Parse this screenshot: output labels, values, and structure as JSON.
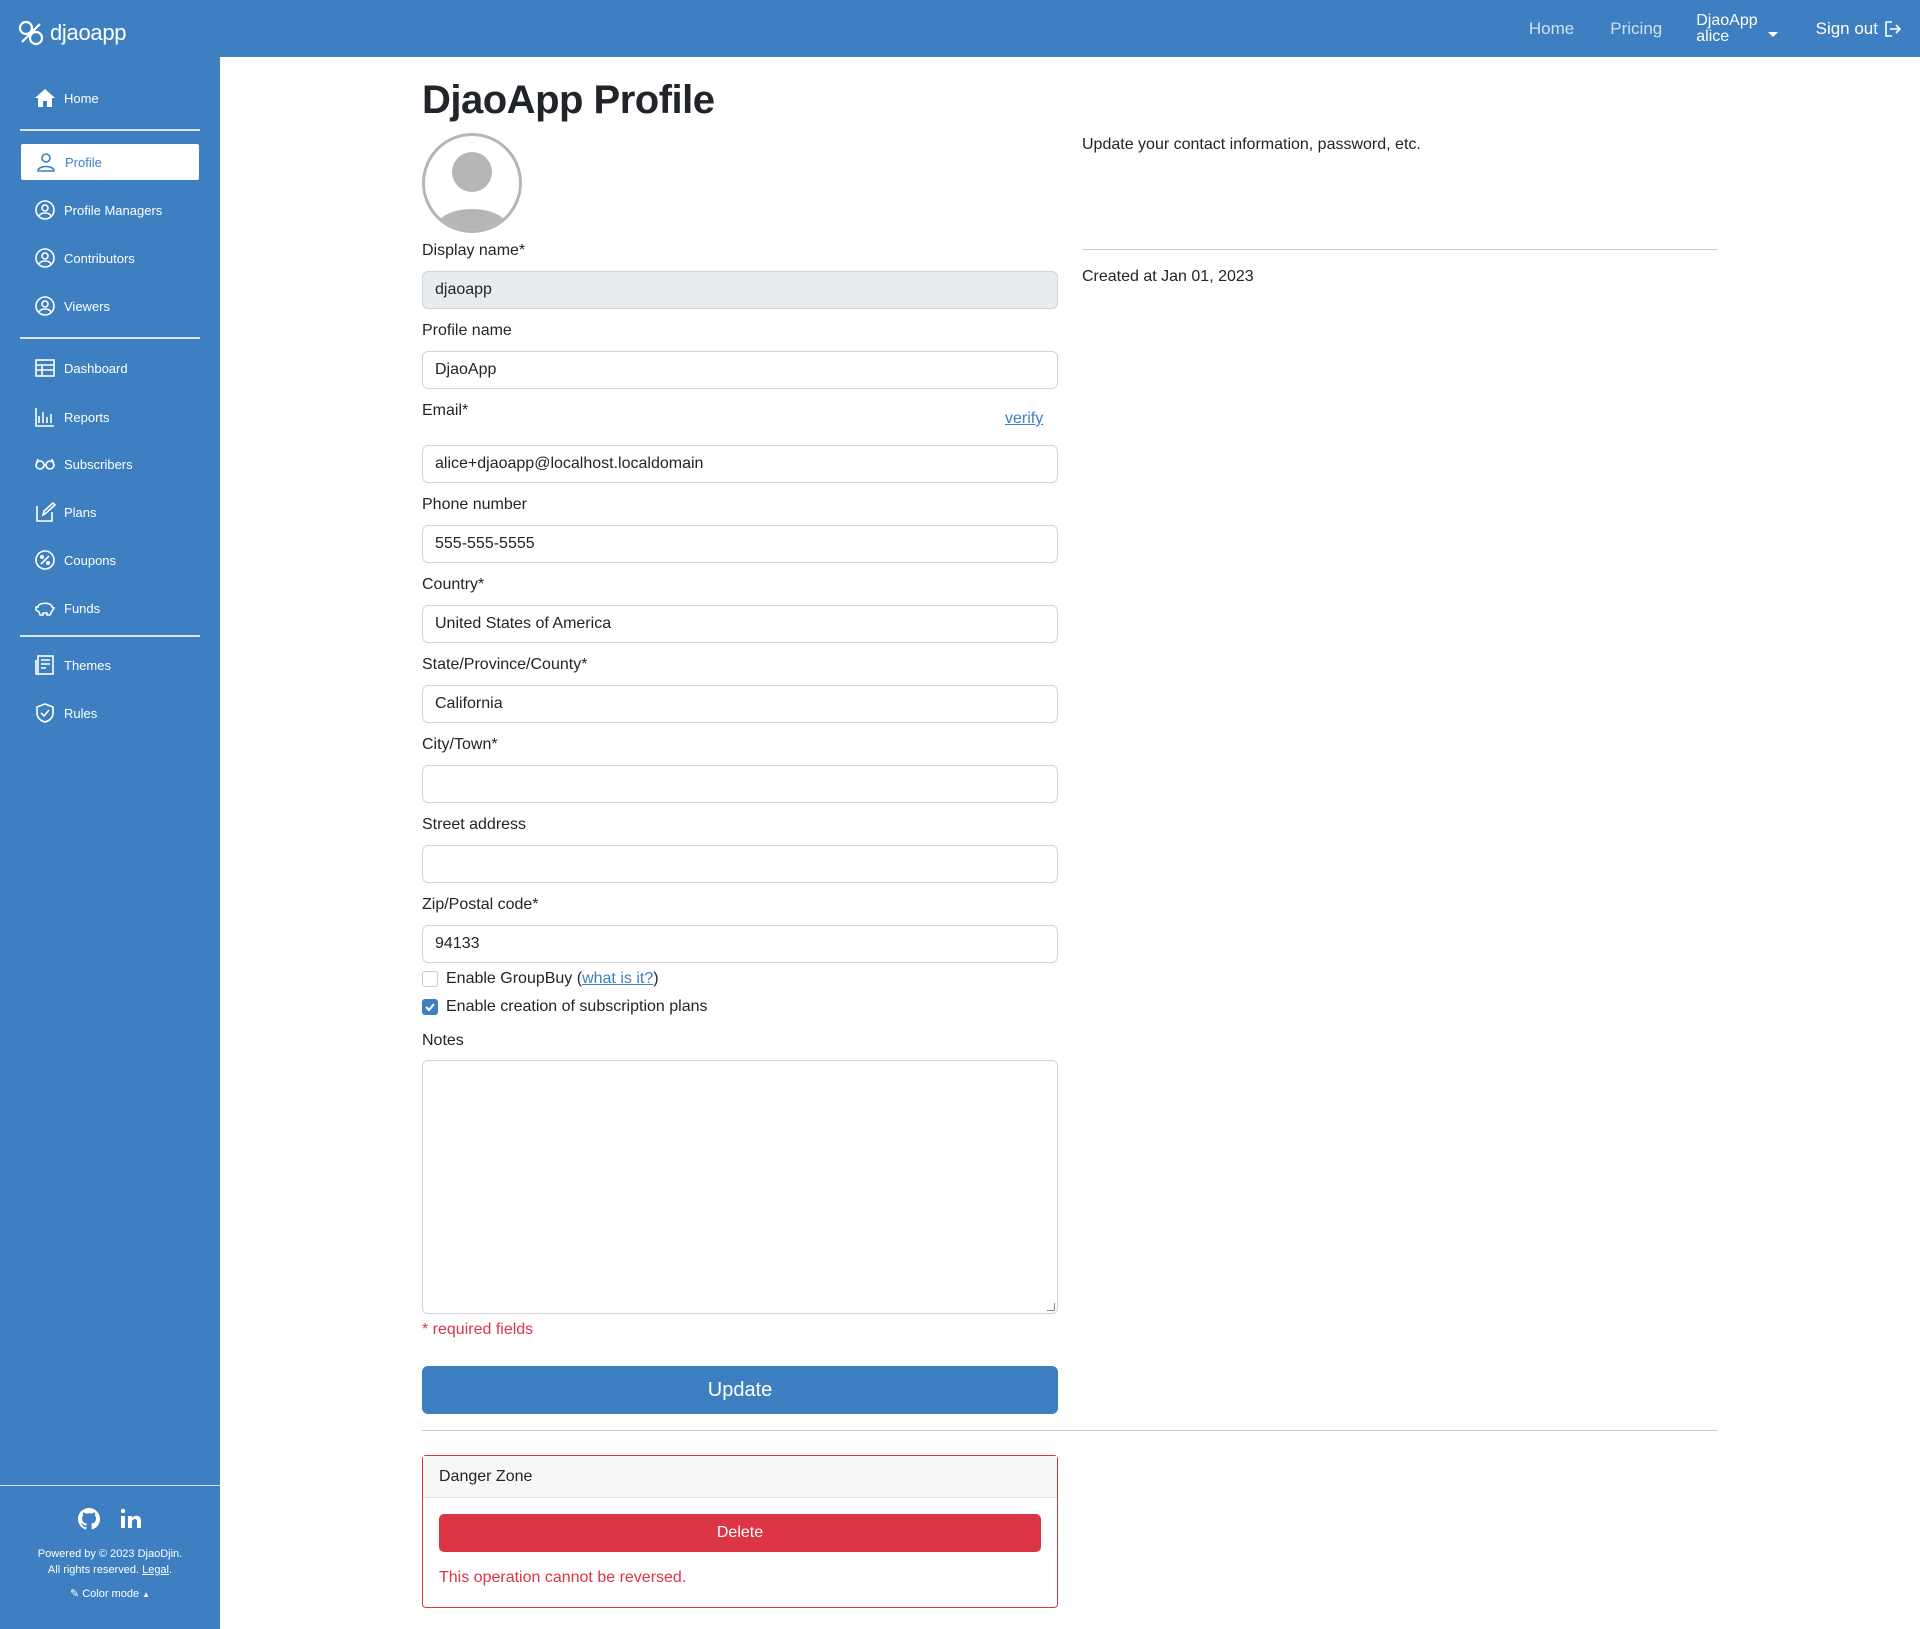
{
  "colors": {
    "brand": "#3d7fc1",
    "danger": "#dc3545"
  },
  "brand": {
    "name": "djaoapp",
    "icon": "djaoapp-logo-icon"
  },
  "topnav": {
    "home": "Home",
    "pricing": "Pricing",
    "user_org": "DjaoApp",
    "user_name": "alice",
    "sign_out": "Sign out"
  },
  "sidebar": {
    "items": [
      {
        "label": "Home",
        "icon": "house-icon"
      },
      {
        "label": "Profile",
        "icon": "person-icon"
      },
      {
        "label": "Profile Managers",
        "icon": "person-circle-icon"
      },
      {
        "label": "Contributors",
        "icon": "person-circle-icon"
      },
      {
        "label": "Viewers",
        "icon": "person-circle-icon"
      },
      {
        "label": "Dashboard",
        "icon": "dashboard-icon"
      },
      {
        "label": "Reports",
        "icon": "chart-icon"
      },
      {
        "label": "Subscribers",
        "icon": "glasses-icon"
      },
      {
        "label": "Plans",
        "icon": "edit-icon"
      },
      {
        "label": "Coupons",
        "icon": "coupon-icon"
      },
      {
        "label": "Funds",
        "icon": "piggy-bank-icon"
      },
      {
        "label": "Themes",
        "icon": "newspaper-icon"
      },
      {
        "label": "Rules",
        "icon": "shield-check-icon"
      }
    ],
    "footer": {
      "powered_line1": "Powered by © 2023 DjaoDjin.",
      "powered_line2": "All rights reserved.",
      "legal": "Legal",
      "color_mode": "Color mode"
    }
  },
  "main": {
    "title": "DjaoApp Profile",
    "description": "Update your contact information, password, etc.",
    "created": "Created at Jan 01, 2023",
    "form": {
      "display_name_label": "Display name*",
      "display_name_value": "djaoapp",
      "profile_name_label": "Profile name",
      "profile_name_value": "DjaoApp",
      "email_label": "Email*",
      "email_verify": "verify",
      "email_value": "alice+djaoapp@localhost.localdomain",
      "phone_label": "Phone number",
      "phone_value": "555-555-5555",
      "country_label": "Country*",
      "country_value": "United States of America",
      "state_label": "State/Province/County*",
      "state_value": "California",
      "city_label": "City/Town*",
      "city_value": "",
      "street_label": "Street address",
      "street_value": "",
      "zip_label": "Zip/Postal code*",
      "zip_value": "94133",
      "groupbuy_label_prefix": "Enable GroupBuy (",
      "groupbuy_link": "what is it?",
      "groupbuy_label_suffix": ")",
      "groupbuy_checked": false,
      "plans_label": "Enable creation of subscription plans",
      "plans_checked": true,
      "notes_label": "Notes",
      "notes_value": "",
      "required_note": "* required fields",
      "update_button": "Update"
    },
    "danger": {
      "title": "Danger Zone",
      "delete_button": "Delete",
      "warning": "This operation cannot be reversed."
    }
  }
}
